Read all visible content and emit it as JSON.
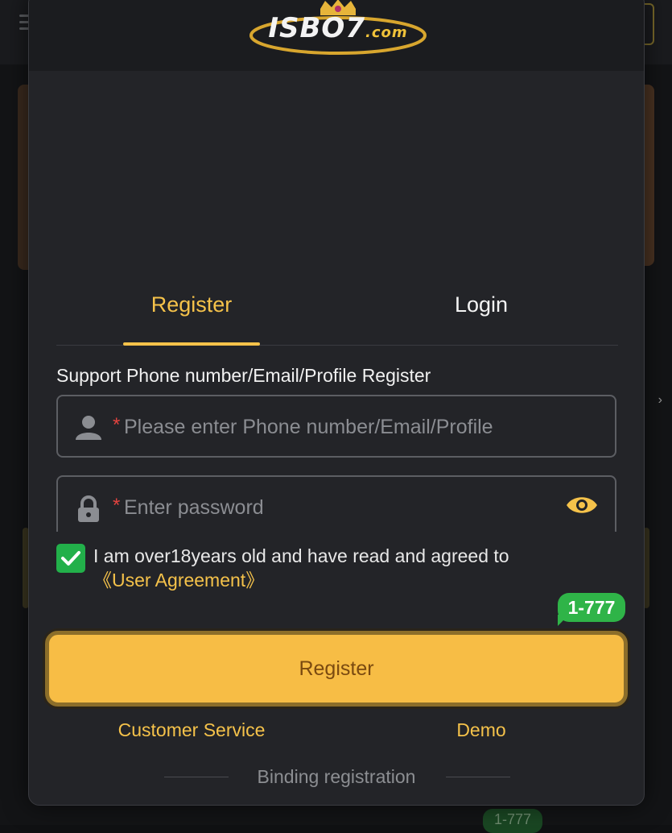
{
  "logo": {
    "text": "ISBO7",
    "domain": ".com"
  },
  "tabs": [
    {
      "label": "Register",
      "active": true
    },
    {
      "label": "Login",
      "active": false
    }
  ],
  "form": {
    "support_label": "Support Phone number/Email/Profile Register",
    "phone_field": {
      "required_mark": "*",
      "placeholder": "Please enter Phone number/Email/Profile",
      "value": ""
    },
    "password_field": {
      "required_mark": "*",
      "placeholder": "Enter password",
      "value": ""
    }
  },
  "agreement": {
    "checked": true,
    "text": "I am over18years old and have read and agreed to",
    "link": "《User Agreement》"
  },
  "badge": "1-777",
  "register_button": "Register",
  "footer": {
    "customer_service": "Customer Service",
    "demo": "Demo",
    "binding": "Binding registration"
  },
  "background": {
    "bottom_badge": "1-777"
  },
  "colors": {
    "accent": "#f5c24a",
    "button": "#f7bd45",
    "checkbox": "#22b04a",
    "badge": "#2fb448",
    "required": "#e2433f",
    "modal_bg": "#232428"
  },
  "icons": {
    "phone_field": "user-icon",
    "password_field": "lock-icon",
    "password_toggle": "eye-icon",
    "checkbox": "checkmark-icon"
  }
}
